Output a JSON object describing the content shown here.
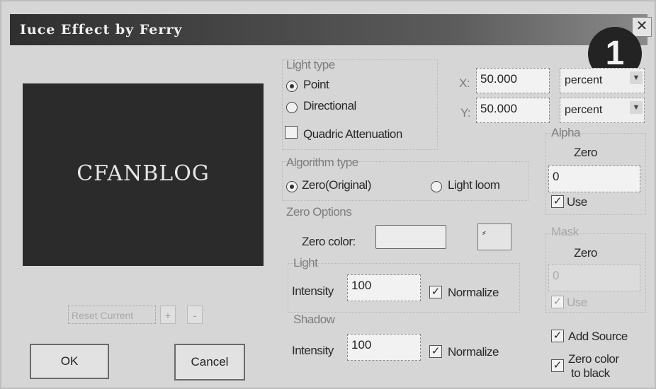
{
  "window": {
    "title": "Iuce Effect by Ferry",
    "close_glyph": "✕"
  },
  "annotation_badge": "1",
  "preview": {
    "logo_text": "CFANBLOG"
  },
  "preset": {
    "combo_text": "Reset Current",
    "plus": "+",
    "minus": "-"
  },
  "buttons": {
    "ok": "OK",
    "cancel": "Cancel"
  },
  "light_type": {
    "group_label": "Light type",
    "options": [
      "Point",
      "Directional"
    ],
    "selected": "Point",
    "quadric_label": "Quadric Attenuation",
    "quadric_checked": false
  },
  "position": {
    "x_label": "X:",
    "x_value": "50.000",
    "x_unit": "percent",
    "y_label": "Y:",
    "y_value": "50.000",
    "y_unit": "percent"
  },
  "algorithm": {
    "group_label": "Algorithm type",
    "options": [
      "Zero(Original)",
      "Light loom"
    ],
    "selected": "Zero(Original)"
  },
  "zero_options": {
    "group_label": "Zero Options",
    "zero_color_label": "Zero color:",
    "picker_glyph": "⸗"
  },
  "light": {
    "group_label": "Light",
    "intensity_label": "Intensity",
    "intensity_value": "100",
    "normalize_label": "Normalize",
    "normalize_checked": true
  },
  "shadow": {
    "group_label": "Shadow",
    "intensity_label": "Intensity",
    "intensity_value": "100",
    "normalize_label": "Normalize",
    "normalize_checked": true
  },
  "alpha": {
    "group_label": "Alpha",
    "sub_label": "Zero",
    "value": "0",
    "use_label": "Use",
    "use_checked": true
  },
  "mask": {
    "group_label": "Mask",
    "sub_label": "Zero",
    "value": "0",
    "use_label": "Use",
    "use_checked": true
  },
  "extras": {
    "add_source_label": "Add Source",
    "add_source_checked": true,
    "zero_black_label_1": "Zero color",
    "zero_black_label_2": "to black",
    "zero_black_checked": true
  },
  "check_glyph": "✓"
}
